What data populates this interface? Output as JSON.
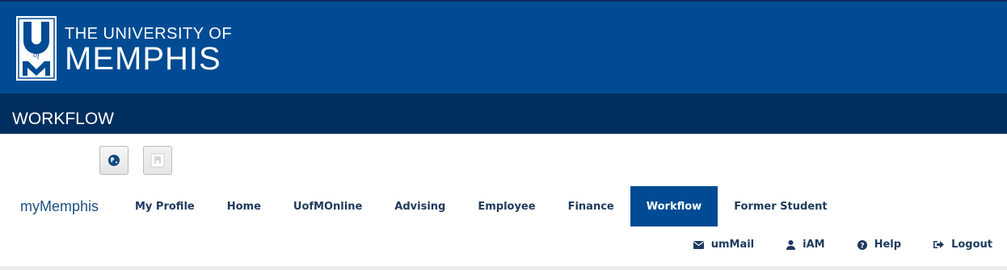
{
  "header": {
    "logo_line1": "THE UNIVERSITY OF",
    "logo_line2": "MEMPHIS",
    "logo_seal_text": "UofM",
    "section_title": "WORKFLOW"
  },
  "toolbar": {
    "buttons": [
      {
        "icon": "globe-icon"
      },
      {
        "icon": "profile-placeholder-icon"
      }
    ]
  },
  "nav": {
    "brand": "myMemphis",
    "items": [
      {
        "label": "My Profile"
      },
      {
        "label": "Home"
      },
      {
        "label": "UofMOnline"
      },
      {
        "label": "Advising"
      },
      {
        "label": "Employee"
      },
      {
        "label": "Finance"
      },
      {
        "label": "Workflow",
        "active": true
      },
      {
        "label": "Former Student"
      }
    ]
  },
  "utility": {
    "links": [
      {
        "label": "umMail",
        "icon": "envelope-icon"
      },
      {
        "label": "iAM",
        "icon": "user-icon"
      },
      {
        "label": "Help",
        "icon": "question-circle-icon"
      },
      {
        "label": "Logout",
        "icon": "sign-out-icon"
      }
    ]
  },
  "colors": {
    "banner_blue": "#004b93",
    "section_navy": "#002f5f",
    "nav_text": "#1e3a5c",
    "brand_text": "#1e4f80"
  }
}
